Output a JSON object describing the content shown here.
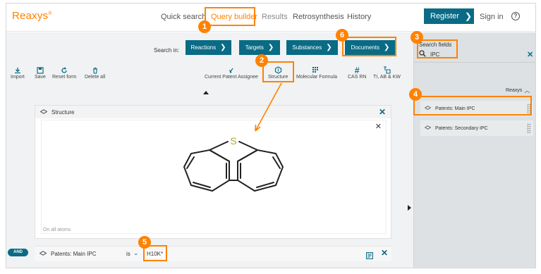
{
  "brand": {
    "logo": "Reaxys",
    "mark": "®"
  },
  "nav": {
    "items": [
      {
        "label": "Quick search"
      },
      {
        "label": "Query builder"
      },
      {
        "label": "Results"
      },
      {
        "label": "Retrosynthesis"
      },
      {
        "label": "History"
      }
    ],
    "register_label": "Register",
    "signin_label": "Sign in",
    "help_glyph": "?"
  },
  "search_in": {
    "label": "Search in:",
    "tabs": [
      {
        "label": "Reactions"
      },
      {
        "label": "Targets"
      },
      {
        "label": "Substances"
      },
      {
        "label": "Documents"
      }
    ]
  },
  "toolbar": {
    "left": [
      {
        "label": "Import",
        "icon": "download-icon"
      },
      {
        "label": "Save",
        "icon": "save-icon"
      },
      {
        "label": "Reset form",
        "icon": "reset-icon"
      },
      {
        "label": "Delete all",
        "icon": "trash-icon"
      }
    ],
    "right": [
      {
        "label": "Current Patent Assignee",
        "icon": "patent-icon"
      },
      {
        "label": "Structure",
        "icon": "structure-icon"
      },
      {
        "label": "Molecular Formula",
        "icon": "formula-icon"
      },
      {
        "label": "CAS RN",
        "icon": "hash-icon"
      },
      {
        "label": "TI, AB & KW",
        "icon": "text-icon"
      }
    ]
  },
  "structure_panel": {
    "title": "Structure",
    "atom_label": "S",
    "footer": "On all atoms"
  },
  "query_row": {
    "connector": "AND",
    "field": "Patents: Main IPC",
    "operator": "is",
    "value": "H10K*"
  },
  "search_fields": {
    "label": "Search fields",
    "query": "IPC",
    "group": "Reaxys",
    "items": [
      {
        "label": "Patents: Main IPC"
      },
      {
        "label": "Patents: Secondary IPC"
      }
    ]
  },
  "callouts": [
    "1",
    "2",
    "3",
    "4",
    "5",
    "6"
  ],
  "colors": {
    "accent": "#ff8200",
    "primary": "#0a6b85"
  }
}
